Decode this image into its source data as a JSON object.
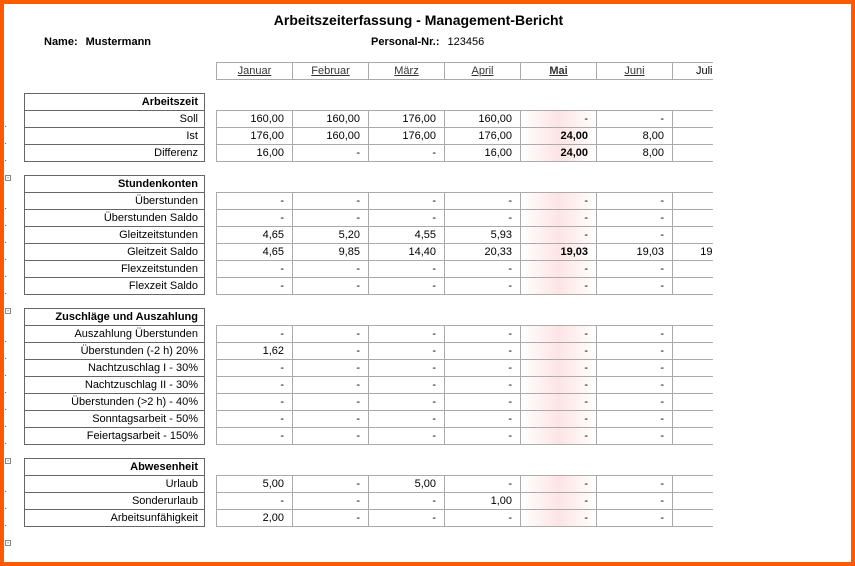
{
  "title": "Arbeitszeiterfassung - Management-Bericht",
  "meta": {
    "name_label": "Name:",
    "name": "Mustermann",
    "pers_label": "Personal-Nr.:",
    "pers": "123456"
  },
  "months": [
    "Januar",
    "Februar",
    "März",
    "April",
    "Mai",
    "Juni",
    "Juli"
  ],
  "current_month_index": 4,
  "sections": [
    {
      "header": "Arbeitszeit",
      "rows": [
        {
          "label": "Soll",
          "v": [
            "160,00",
            "160,00",
            "176,00",
            "160,00",
            "-",
            "-",
            ""
          ]
        },
        {
          "label": "Ist",
          "v": [
            "176,00",
            "160,00",
            "176,00",
            "176,00",
            "24,00",
            "8,00",
            ""
          ]
        },
        {
          "label": "Differenz",
          "v": [
            "16,00",
            "-",
            "-",
            "16,00",
            "24,00",
            "8,00",
            ""
          ]
        }
      ]
    },
    {
      "header": "Stundenkonten",
      "rows": [
        {
          "label": "Überstunden",
          "v": [
            "-",
            "-",
            "-",
            "-",
            "-",
            "-",
            ""
          ]
        },
        {
          "label": "Überstunden Saldo",
          "v": [
            "-",
            "-",
            "-",
            "-",
            "-",
            "-",
            ""
          ]
        },
        {
          "label": "Gleitzeitstunden",
          "v": [
            "4,65",
            "5,20",
            "4,55",
            "5,93",
            "-",
            "-",
            ""
          ]
        },
        {
          "label": "Gleitzeit Saldo",
          "v": [
            "4,65",
            "9,85",
            "14,40",
            "20,33",
            "19,03",
            "19,03",
            "19"
          ]
        },
        {
          "label": "Flexzeitstunden",
          "v": [
            "-",
            "-",
            "-",
            "-",
            "-",
            "-",
            ""
          ]
        },
        {
          "label": "Flexzeit Saldo",
          "v": [
            "-",
            "-",
            "-",
            "-",
            "-",
            "-",
            ""
          ]
        }
      ]
    },
    {
      "header": "Zuschläge und Auszahlung",
      "rows": [
        {
          "label": "Auszahlung Überstunden",
          "v": [
            "-",
            "-",
            "-",
            "-",
            "-",
            "-",
            ""
          ]
        },
        {
          "label": "Überstunden (-2 h) 20%",
          "v": [
            "1,62",
            "-",
            "-",
            "-",
            "-",
            "-",
            ""
          ]
        },
        {
          "label": "Nachtzuschlag I - 30%",
          "v": [
            "-",
            "-",
            "-",
            "-",
            "-",
            "-",
            ""
          ]
        },
        {
          "label": "Nachtzuschlag II - 30%",
          "v": [
            "-",
            "-",
            "-",
            "-",
            "-",
            "-",
            ""
          ]
        },
        {
          "label": "Überstunden (>2 h) - 40%",
          "v": [
            "-",
            "-",
            "-",
            "-",
            "-",
            "-",
            ""
          ]
        },
        {
          "label": "Sonntagsarbeit - 50%",
          "v": [
            "-",
            "-",
            "-",
            "-",
            "-",
            "-",
            ""
          ]
        },
        {
          "label": "Feiertagsarbeit - 150%",
          "v": [
            "-",
            "-",
            "-",
            "-",
            "-",
            "-",
            ""
          ]
        }
      ]
    },
    {
      "header": "Abwesenheit",
      "rows": [
        {
          "label": "Urlaub",
          "v": [
            "5,00",
            "-",
            "5,00",
            "-",
            "-",
            "-",
            ""
          ]
        },
        {
          "label": "Sonderurlaub",
          "v": [
            "-",
            "-",
            "-",
            "1,00",
            "-",
            "-",
            ""
          ]
        },
        {
          "label": "Arbeitsunfähigkeit",
          "v": [
            "2,00",
            "-",
            "-",
            "-",
            "-",
            "-",
            ""
          ]
        }
      ]
    }
  ],
  "chart_data": {
    "type": "table",
    "title": "Arbeitszeiterfassung - Management-Bericht",
    "categories": [
      "Januar",
      "Februar",
      "März",
      "April",
      "Mai",
      "Juni",
      "Juli"
    ],
    "series": [
      {
        "name": "Soll",
        "values": [
          160.0,
          160.0,
          176.0,
          160.0,
          null,
          null,
          null
        ]
      },
      {
        "name": "Ist",
        "values": [
          176.0,
          160.0,
          176.0,
          176.0,
          24.0,
          8.0,
          null
        ]
      },
      {
        "name": "Differenz",
        "values": [
          16.0,
          null,
          null,
          16.0,
          24.0,
          8.0,
          null
        ]
      },
      {
        "name": "Überstunden",
        "values": [
          null,
          null,
          null,
          null,
          null,
          null,
          null
        ]
      },
      {
        "name": "Überstunden Saldo",
        "values": [
          null,
          null,
          null,
          null,
          null,
          null,
          null
        ]
      },
      {
        "name": "Gleitzeitstunden",
        "values": [
          4.65,
          5.2,
          4.55,
          5.93,
          null,
          null,
          null
        ]
      },
      {
        "name": "Gleitzeit Saldo",
        "values": [
          4.65,
          9.85,
          14.4,
          20.33,
          19.03,
          19.03,
          19
        ]
      },
      {
        "name": "Flexzeitstunden",
        "values": [
          null,
          null,
          null,
          null,
          null,
          null,
          null
        ]
      },
      {
        "name": "Flexzeit Saldo",
        "values": [
          null,
          null,
          null,
          null,
          null,
          null,
          null
        ]
      },
      {
        "name": "Auszahlung Überstunden",
        "values": [
          null,
          null,
          null,
          null,
          null,
          null,
          null
        ]
      },
      {
        "name": "Überstunden (-2 h) 20%",
        "values": [
          1.62,
          null,
          null,
          null,
          null,
          null,
          null
        ]
      },
      {
        "name": "Nachtzuschlag I - 30%",
        "values": [
          null,
          null,
          null,
          null,
          null,
          null,
          null
        ]
      },
      {
        "name": "Nachtzuschlag II - 30%",
        "values": [
          null,
          null,
          null,
          null,
          null,
          null,
          null
        ]
      },
      {
        "name": "Überstunden (>2 h) - 40%",
        "values": [
          null,
          null,
          null,
          null,
          null,
          null,
          null
        ]
      },
      {
        "name": "Sonntagsarbeit - 50%",
        "values": [
          null,
          null,
          null,
          null,
          null,
          null,
          null
        ]
      },
      {
        "name": "Feiertagsarbeit - 150%",
        "values": [
          null,
          null,
          null,
          null,
          null,
          null,
          null
        ]
      },
      {
        "name": "Urlaub",
        "values": [
          5.0,
          null,
          5.0,
          null,
          null,
          null,
          null
        ]
      },
      {
        "name": "Sonderurlaub",
        "values": [
          null,
          null,
          null,
          1.0,
          null,
          null,
          null
        ]
      },
      {
        "name": "Arbeitsunfähigkeit",
        "values": [
          2.0,
          null,
          null,
          null,
          null,
          null,
          null
        ]
      }
    ]
  }
}
